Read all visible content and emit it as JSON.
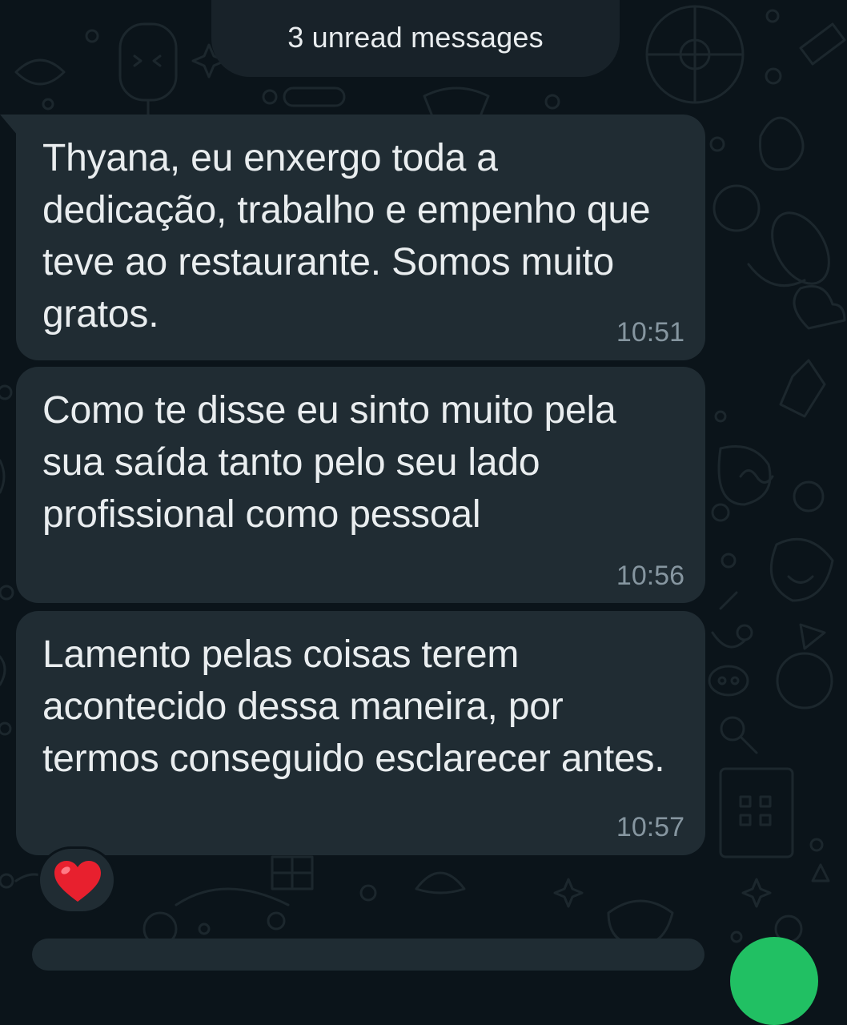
{
  "chat": {
    "unread_banner": "3 unread messages",
    "messages": [
      {
        "text": "Thyana, eu enxergo toda a dedicação, trabalho e empenho que teve ao restaurante. Somos muito gratos.",
        "time": "10:51"
      },
      {
        "text": "Como te disse eu sinto muito pela sua saída tanto pelo seu lado profissional como pessoal",
        "time": "10:56"
      },
      {
        "text": "Lamento pelas coisas terem acontecido dessa maneira, por termos conseguido esclarecer antes.",
        "time": "10:57"
      }
    ],
    "reaction": {
      "icon": "red-heart-icon",
      "color": "#e8202e"
    }
  },
  "theme": {
    "background": "#0b141a",
    "bubble": "#202c33",
    "text": "#e9edef",
    "timestamp": "#8696a0",
    "accent": "#21c063"
  }
}
